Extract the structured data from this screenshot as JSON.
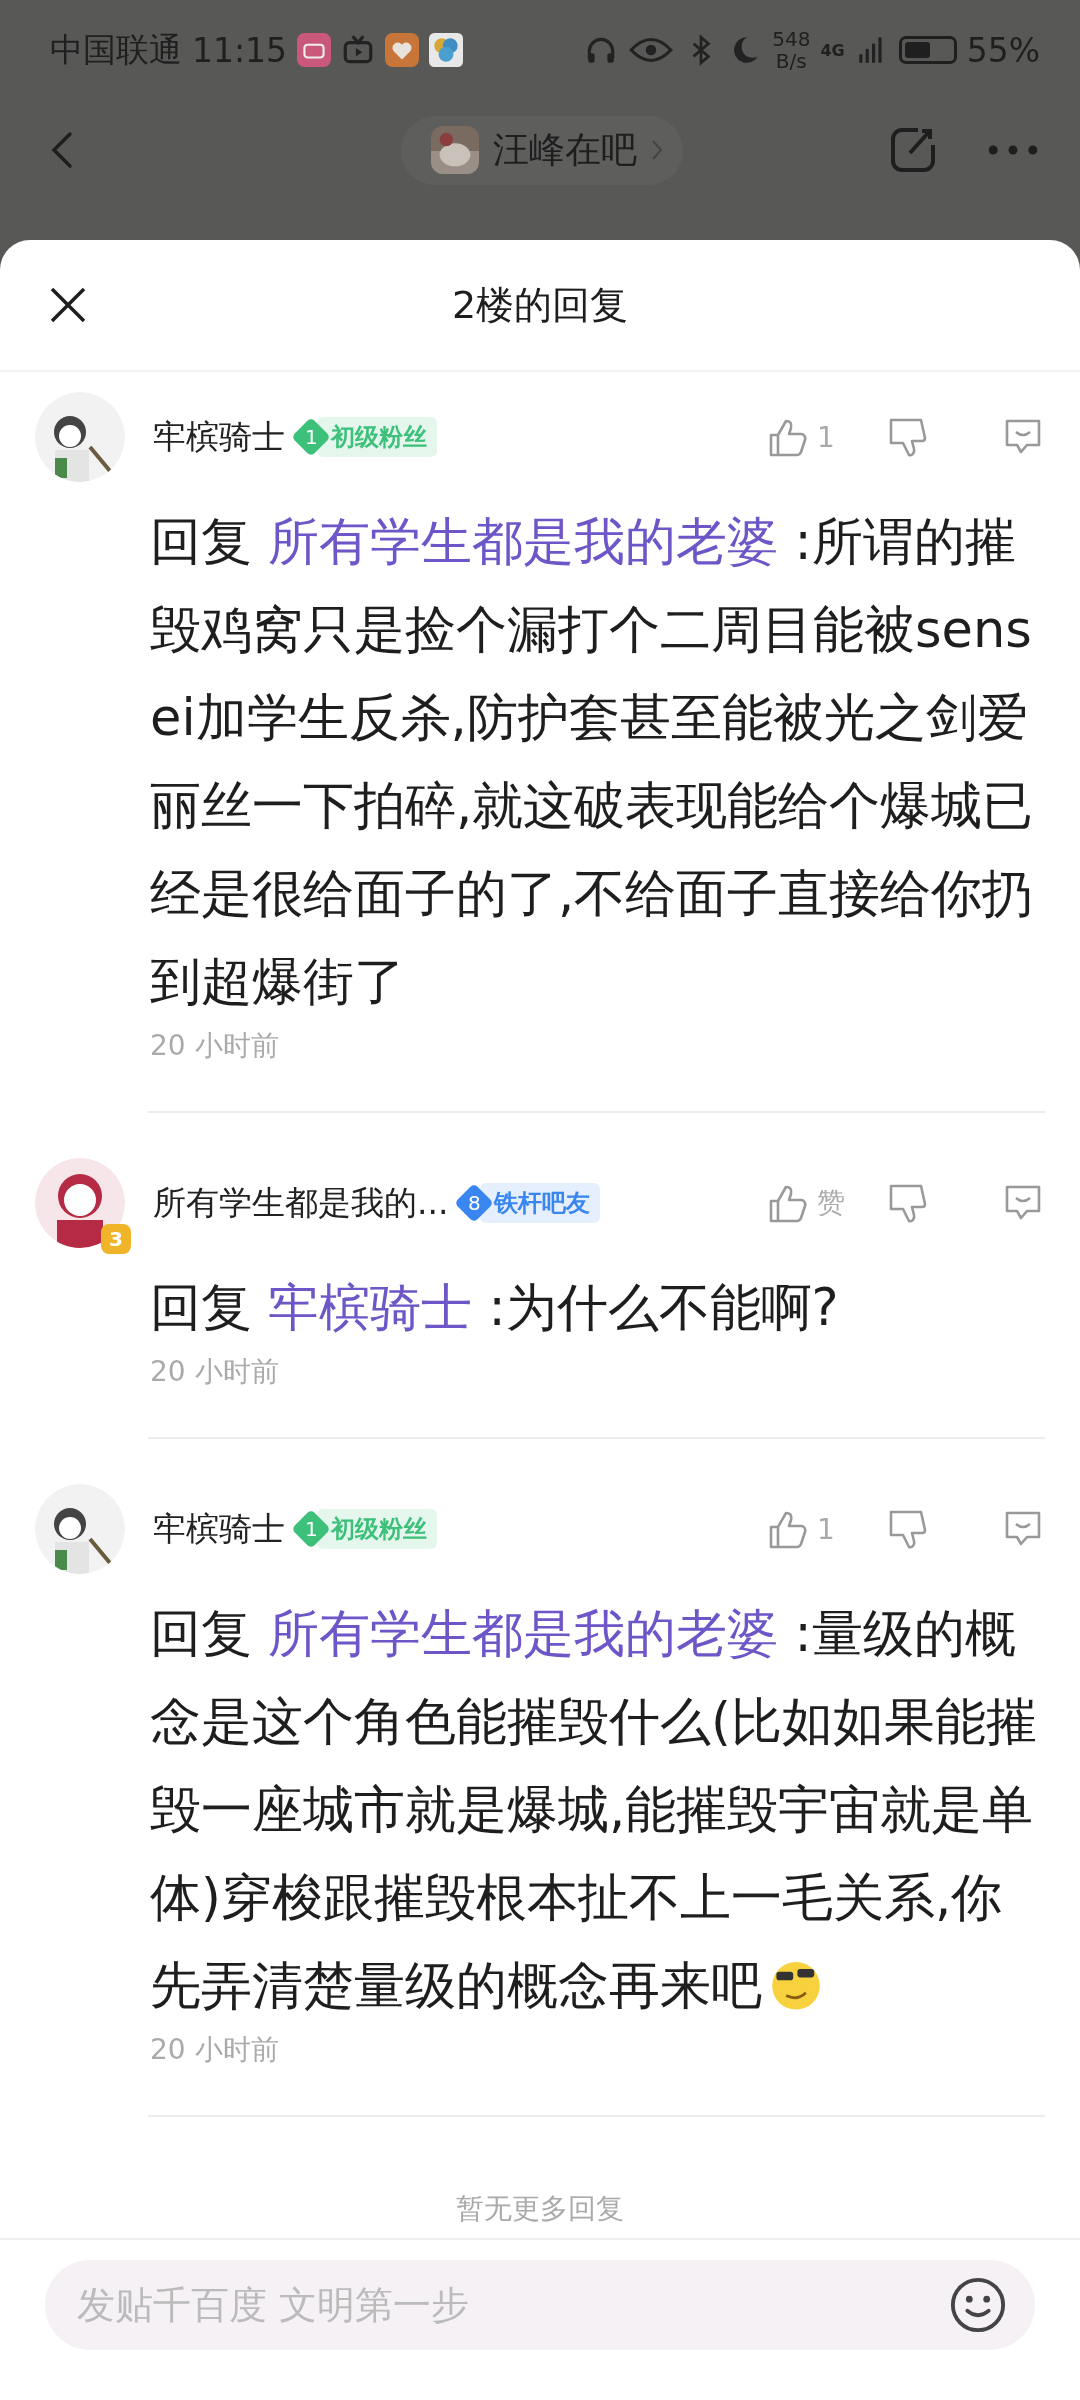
{
  "status_bar": {
    "carrier": "中国联通",
    "time": "11:15",
    "net_speed": "548",
    "net_unit": "B/s",
    "network": "4G",
    "battery": "55%"
  },
  "top_bar": {
    "forum": "汪峰在吧"
  },
  "sheet": {
    "title": "2楼的回复"
  },
  "comments": [
    {
      "author": "牢槟骑士",
      "badge": {
        "level": "1",
        "label": "初级粉丝",
        "color": "#3cc07a"
      },
      "like": "1",
      "reply_prefix": "回复",
      "reply_to": "所有学生都是我的老婆",
      "text": ":所谓的摧毁鸡窝只是捡个漏打个二周目能被sensei加学生反杀,防护套甚至能被光之剑爱丽丝一下拍碎,就这破表现能给个爆城已经是很给面子的了,不给面子直接给你扔到超爆街了",
      "emoji": false,
      "time": "20 小时前"
    },
    {
      "author": "所有学生都是我的...",
      "badge": {
        "level": "8",
        "label": "铁杆吧友",
        "color": "#3a86f0"
      },
      "avatar_badge": "3",
      "like": "赞",
      "reply_prefix": "回复",
      "reply_to": "牢槟骑士",
      "text": ":为什么不能啊?",
      "emoji": false,
      "time": "20 小时前"
    },
    {
      "author": "牢槟骑士",
      "badge": {
        "level": "1",
        "label": "初级粉丝",
        "color": "#3cc07a"
      },
      "like": "1",
      "reply_prefix": "回复",
      "reply_to": "所有学生都是我的老婆",
      "text": ":量级的概念是这个角色能摧毁什么(比如如果能摧毁一座城市就是爆城,能摧毁宇宙就是单体)穿梭跟摧毁根本扯不上一毛关系,你先弄清楚量级的概念再来吧",
      "emoji": true,
      "time": "20 小时前"
    }
  ],
  "end_note": "暂无更多回复",
  "input": {
    "placeholder": "发贴千百度 文明第一步"
  }
}
